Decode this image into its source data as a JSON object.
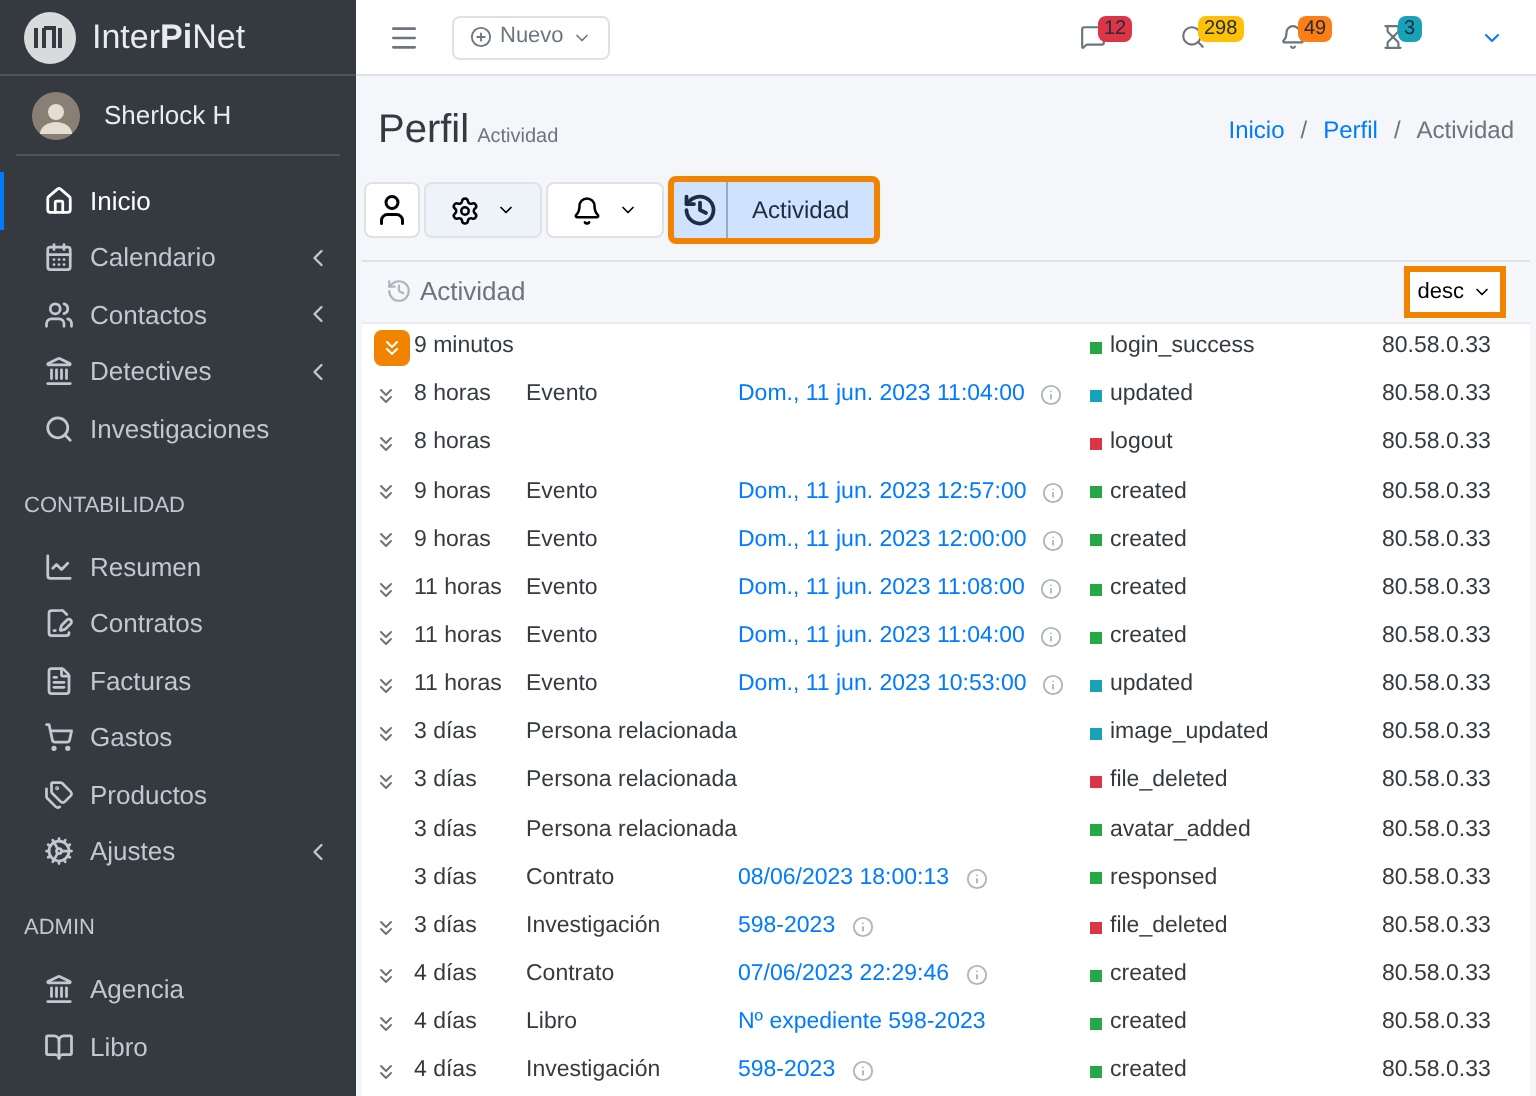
{
  "brand": {
    "name": "Inter**Pi**Net"
  },
  "user": {
    "name": "Sherlock H"
  },
  "sidebar": {
    "sections": [
      {
        "items": [
          {
            "label": "Inicio",
            "selected": true,
            "submenu": false
          },
          {
            "label": "Calendario",
            "selected": false,
            "submenu": true
          },
          {
            "label": "Contactos",
            "selected": false,
            "submenu": true
          },
          {
            "label": "Detectives",
            "selected": false,
            "submenu": true
          },
          {
            "label": "Investigaciones",
            "selected": false,
            "submenu": false
          }
        ]
      },
      {
        "header": "CONTABILIDAD",
        "items": [
          {
            "label": "Resumen",
            "selected": false,
            "submenu": false
          },
          {
            "label": "Contratos",
            "selected": false,
            "submenu": false
          },
          {
            "label": "Facturas",
            "selected": false,
            "submenu": false
          },
          {
            "label": "Gastos",
            "selected": false,
            "submenu": false
          },
          {
            "label": "Productos",
            "selected": false,
            "submenu": false
          },
          {
            "label": "Ajustes",
            "selected": false,
            "submenu": true
          }
        ]
      },
      {
        "header": "ADMIN",
        "items": [
          {
            "label": "Agencia",
            "selected": false,
            "submenu": false
          },
          {
            "label": "Libro",
            "selected": false,
            "submenu": false
          }
        ]
      }
    ]
  },
  "topbar": {
    "new_button": "Nuevo",
    "notifications": [
      {
        "count": "12",
        "color": "#dc3545"
      },
      {
        "count": "298",
        "color": "#ffc107"
      },
      {
        "count": "49",
        "color": "#fd7e14"
      },
      {
        "count": "3",
        "color": "#17a2b8"
      }
    ]
  },
  "page": {
    "title": "Perfil",
    "subtitle": "Actividad",
    "breadcrumb": [
      {
        "kind": "link",
        "label": "Inicio"
      },
      {
        "kind": "separator",
        "label": "/"
      },
      {
        "kind": "link",
        "label": "Perfil"
      },
      {
        "kind": "separator",
        "label": "/"
      },
      {
        "kind": "current",
        "label": "Actividad"
      }
    ]
  },
  "toolbar": [
    {
      "kind": "user"
    },
    {
      "kind": "settings"
    },
    {
      "kind": "bell"
    },
    {
      "kind": "activity",
      "label": "Actividad",
      "selected": true,
      "highlighted": true
    }
  ],
  "card": {
    "title": "Actividad",
    "sort": {
      "value": "desc",
      "highlighted": true
    }
  },
  "rows": [
    {
      "expandable": true,
      "highlighted": true,
      "time": "9 minutos",
      "status": "login_success",
      "color": "#28a745",
      "ip": "80.58.0.33"
    },
    {
      "expandable": true,
      "time": "8 horas",
      "type": "Evento",
      "link": "Dom., 11 jun. 2023 11:04:00",
      "info": true,
      "status": "updated",
      "color": "#17a2b8",
      "ip": "80.58.0.33"
    },
    {
      "expandable": true,
      "time": "8 horas",
      "status": "logout",
      "color": "#dc3545",
      "ip": "80.58.0.33"
    },
    {
      "expandable": true,
      "time": "9 horas",
      "type": "Evento",
      "link": "Dom., 11 jun. 2023 12:57:00",
      "info": true,
      "status": "created",
      "color": "#28a745",
      "ip": "80.58.0.33"
    },
    {
      "expandable": true,
      "time": "9 horas",
      "type": "Evento",
      "link": "Dom., 11 jun. 2023 12:00:00",
      "info": true,
      "status": "created",
      "color": "#28a745",
      "ip": "80.58.0.33"
    },
    {
      "expandable": true,
      "time": "11 horas",
      "type": "Evento",
      "link": "Dom., 11 jun. 2023 11:08:00",
      "info": true,
      "status": "created",
      "color": "#28a745",
      "ip": "80.58.0.33"
    },
    {
      "expandable": true,
      "time": "11 horas",
      "type": "Evento",
      "link": "Dom., 11 jun. 2023 11:04:00",
      "info": true,
      "status": "created",
      "color": "#28a745",
      "ip": "80.58.0.33"
    },
    {
      "expandable": true,
      "time": "11 horas",
      "type": "Evento",
      "link": "Dom., 11 jun. 2023 10:53:00",
      "info": true,
      "status": "updated",
      "color": "#17a2b8",
      "ip": "80.58.0.33"
    },
    {
      "expandable": true,
      "time": "3 días",
      "type": "Persona relacionada",
      "status": "image_updated",
      "color": "#17a2b8",
      "ip": "80.58.0.33"
    },
    {
      "expandable": true,
      "time": "3 días",
      "type": "Persona relacionada",
      "status": "file_deleted",
      "color": "#dc3545",
      "ip": "80.58.0.33"
    },
    {
      "expandable": false,
      "time": "3 días",
      "type": "Persona relacionada",
      "status": "avatar_added",
      "color": "#28a745",
      "ip": "80.58.0.33"
    },
    {
      "expandable": false,
      "time": "3 días",
      "type": "Contrato",
      "link": "08/06/2023 18:00:13",
      "info": true,
      "status": "responsed",
      "color": "#28a745",
      "ip": "80.58.0.33"
    },
    {
      "expandable": true,
      "time": "3 días",
      "type": "Investigación",
      "link": "598-2023",
      "info": true,
      "status": "file_deleted",
      "color": "#dc3545",
      "ip": "80.58.0.33"
    },
    {
      "expandable": true,
      "time": "4 días",
      "type": "Contrato",
      "link": "07/06/2023 22:29:46",
      "info": true,
      "status": "created",
      "color": "#28a745",
      "ip": "80.58.0.33"
    },
    {
      "expandable": true,
      "time": "4 días",
      "type": "Libro",
      "link": "Nº expediente 598-2023",
      "info": false,
      "status": "created",
      "color": "#28a745",
      "ip": "80.58.0.33"
    },
    {
      "expandable": true,
      "time": "4 días",
      "type": "Investigación",
      "link": "598-2023",
      "info": true,
      "status": "created",
      "color": "#28a745",
      "ip": "80.58.0.33"
    }
  ]
}
